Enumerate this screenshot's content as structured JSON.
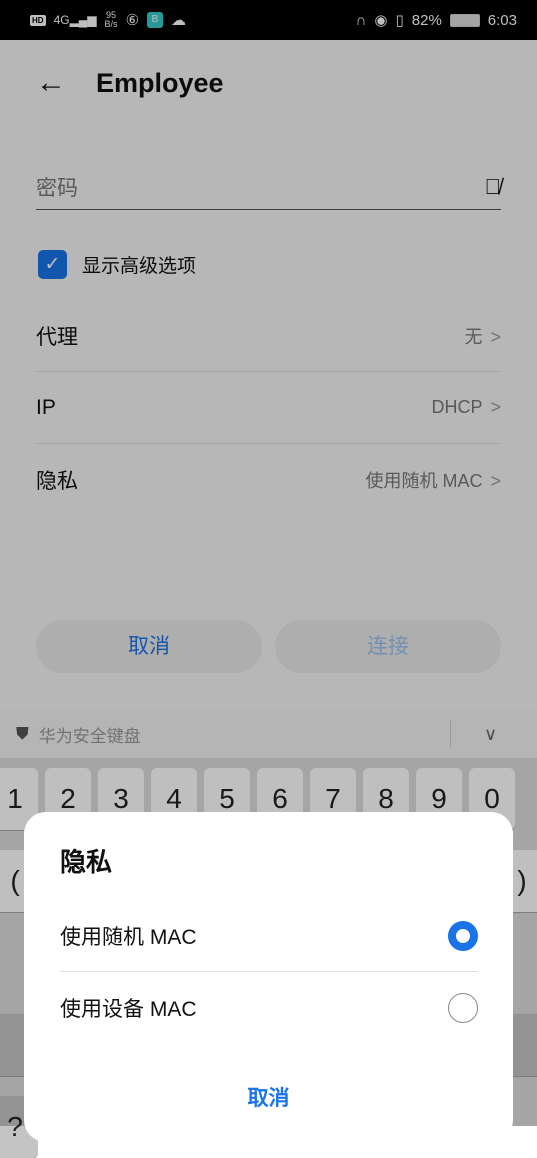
{
  "status_bar": {
    "network": "4G",
    "speed_value": "95",
    "speed_unit": "B/s",
    "battery": "82%",
    "time": "6:03"
  },
  "header": {
    "title": "Employee"
  },
  "password": {
    "placeholder": "密码"
  },
  "advanced": {
    "label": "显示高级选项",
    "checked": true
  },
  "settings": [
    {
      "label": "代理",
      "value": "无"
    },
    {
      "label": "IP",
      "value": "DHCP"
    },
    {
      "label": "隐私",
      "value": "使用随机 MAC"
    }
  ],
  "buttons": {
    "cancel": "取消",
    "connect": "连接"
  },
  "keyboard": {
    "title": "华为安全键盘",
    "row1": [
      "1",
      "2",
      "3",
      "4",
      "5",
      "6",
      "7",
      "8",
      "9",
      "0"
    ],
    "row2_first": "(",
    "row2_last": ")",
    "row4_first": "?"
  },
  "dialog": {
    "title": "隐私",
    "options": [
      {
        "label": "使用随机 MAC",
        "selected": true
      },
      {
        "label": "使用设备 MAC",
        "selected": false
      }
    ],
    "cancel": "取消"
  },
  "colors": {
    "accent": "#1a73e8"
  }
}
